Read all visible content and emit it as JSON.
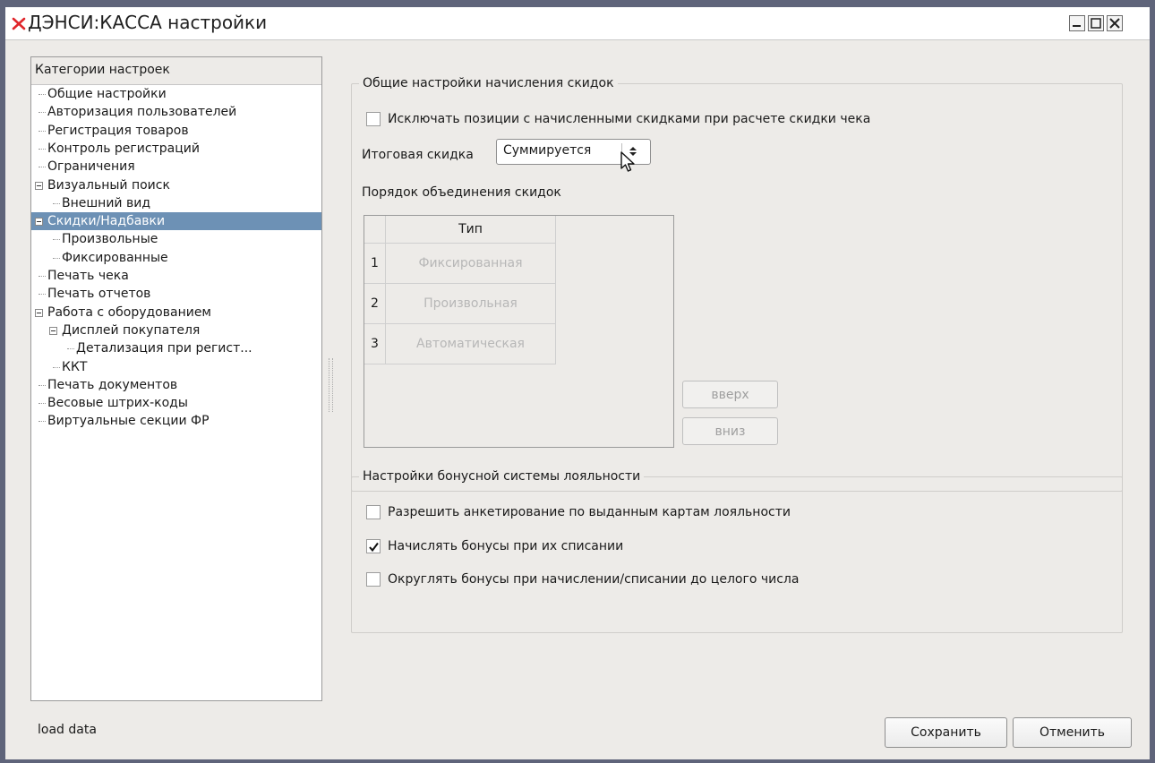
{
  "window": {
    "title": "ДЭНСИ:КАССА настройки",
    "accent_color": "#e0262b"
  },
  "tree": {
    "header": "Категории настроек",
    "items": [
      {
        "label": "Общие настройки",
        "level": 1
      },
      {
        "label": "Авторизация пользователей",
        "level": 1
      },
      {
        "label": "Регистрация товаров",
        "level": 1
      },
      {
        "label": "Контроль регистраций",
        "level": 1
      },
      {
        "label": "Ограничения",
        "level": 1
      },
      {
        "label": "Визуальный поиск",
        "level": 1,
        "expanded": true
      },
      {
        "label": "Внешний вид",
        "level": 2
      },
      {
        "label": "Скидки/Надбавки",
        "level": 1,
        "expanded": true,
        "selected": true
      },
      {
        "label": "Произвольные",
        "level": 2
      },
      {
        "label": "Фиксированные",
        "level": 2
      },
      {
        "label": "Печать чека",
        "level": 1
      },
      {
        "label": "Печать отчетов",
        "level": 1
      },
      {
        "label": "Работа с оборудованием",
        "level": 1,
        "expanded": true
      },
      {
        "label": "Дисплей покупателя",
        "level": 2,
        "expanded": true
      },
      {
        "label": "Детализация при регист...",
        "level": 3
      },
      {
        "label": "ККТ",
        "level": 2
      },
      {
        "label": "Печать документов",
        "level": 1
      },
      {
        "label": "Весовые штрих-коды",
        "level": 1
      },
      {
        "label": "Виртуальные секции ФР",
        "level": 1
      }
    ]
  },
  "discounts": {
    "group_title": "Общие настройки начисления скидок",
    "exclude_label": "Исключать позиции с начисленными скидками при расчете скидки чека",
    "exclude_checked": false,
    "total_label": "Итоговая скидка",
    "total_value": "Суммируется",
    "order_label": "Порядок объединения скидок",
    "table": {
      "column": "Тип",
      "rows": [
        {
          "num": "1",
          "type": "Фиксированная"
        },
        {
          "num": "2",
          "type": "Произвольная"
        },
        {
          "num": "3",
          "type": "Автоматическая"
        }
      ]
    },
    "up_button": "вверх",
    "down_button": "вниз"
  },
  "bonus": {
    "group_title": "Настройки бонусной системы лояльности",
    "options": [
      {
        "label": "Разрешить анкетирование по выданным картам лояльности",
        "checked": false
      },
      {
        "label": "Начислять бонусы при их списании",
        "checked": true
      },
      {
        "label": "Округлять бонусы при начислении/списании до целого числа",
        "checked": false
      }
    ]
  },
  "footer": {
    "status": "load data",
    "save_button": "Сохранить",
    "cancel_button": "Отменить"
  }
}
